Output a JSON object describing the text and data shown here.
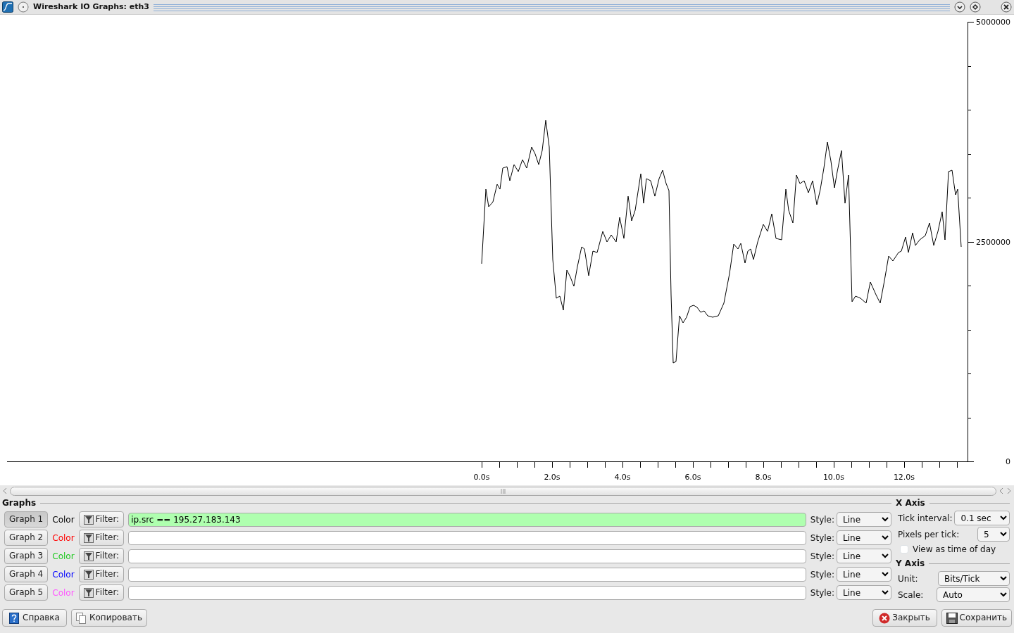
{
  "window": {
    "title": "Wireshark IO Graphs: eth3"
  },
  "chart": {
    "chart_data": {
      "type": "line",
      "x": [
        0,
        0.12,
        0.2,
        0.32,
        0.44,
        0.52,
        0.6,
        0.72,
        0.8,
        0.92,
        1.04,
        1.16,
        1.28,
        1.42,
        1.52,
        1.62,
        1.72,
        1.82,
        1.92,
        2.02,
        2.12,
        2.22,
        2.32,
        2.42,
        2.52,
        2.62,
        2.72,
        2.84,
        2.92,
        3.04,
        3.16,
        3.28,
        3.44,
        3.56,
        3.68,
        3.82,
        3.92,
        4.04,
        4.16,
        4.26,
        4.36,
        4.52,
        4.6,
        4.68,
        4.8,
        4.92,
        5.04,
        5.14,
        5.24,
        5.32,
        5.38,
        5.44,
        5.52,
        5.62,
        5.72,
        5.82,
        5.92,
        6.02,
        6.12,
        6.22,
        6.32,
        6.42,
        6.56,
        6.72,
        6.88,
        7.04,
        7.16,
        7.28,
        7.36,
        7.48,
        7.56,
        7.64,
        7.72,
        7.84,
        8.0,
        8.12,
        8.24,
        8.36,
        8.52,
        8.64,
        8.72,
        8.84,
        8.94,
        9.04,
        9.16,
        9.28,
        9.4,
        9.52,
        9.62,
        9.72,
        9.82,
        9.92,
        10.02,
        10.1,
        10.22,
        10.32,
        10.42,
        10.52,
        10.62,
        10.76,
        10.92,
        11.04,
        11.2,
        11.32,
        11.44,
        11.56,
        11.68,
        11.84,
        11.92,
        12.04,
        12.12,
        12.24,
        12.32,
        12.44,
        12.6,
        12.72,
        12.84,
        12.96,
        13.08,
        13.16,
        13.26,
        13.36,
        13.46,
        13.52,
        13.62
      ],
      "series": [
        {
          "color": "#000000",
          "values": [
            2248000,
            3096000,
            2896000,
            2952000,
            3152000,
            3096000,
            3336000,
            3352000,
            3192000,
            3376000,
            3296000,
            3432000,
            3336000,
            3576000,
            3496000,
            3376000,
            3536000,
            3880000,
            3576000,
            2296000,
            1856000,
            1880000,
            1720000,
            2176000,
            2096000,
            1992000,
            2216000,
            2440000,
            2416000,
            2112000,
            2392000,
            2376000,
            2616000,
            2496000,
            2576000,
            2496000,
            2776000,
            2536000,
            3016000,
            2736000,
            2856000,
            3272000,
            2936000,
            3216000,
            3192000,
            3016000,
            3216000,
            3312000,
            3160000,
            3080000,
            1896000,
            1120000,
            1136000,
            1656000,
            1576000,
            1640000,
            1760000,
            1776000,
            1752000,
            1696000,
            1712000,
            1656000,
            1640000,
            1656000,
            1800000,
            2136000,
            2472000,
            2416000,
            2480000,
            2256000,
            2392000,
            2416000,
            2296000,
            2496000,
            2696000,
            2616000,
            2816000,
            2536000,
            2520000,
            3096000,
            2856000,
            2712000,
            3256000,
            3160000,
            3192000,
            3056000,
            3192000,
            2920000,
            3096000,
            3336000,
            3632000,
            3416000,
            3112000,
            3296000,
            3536000,
            2936000,
            3256000,
            1816000,
            1880000,
            1856000,
            1800000,
            2040000,
            1896000,
            1800000,
            2056000,
            2336000,
            2280000,
            2376000,
            2392000,
            2552000,
            2376000,
            2600000,
            2456000,
            2520000,
            2568000,
            2712000,
            2456000,
            2616000,
            2840000,
            2520000,
            3296000,
            3312000,
            3032000,
            3096000,
            2440000
          ]
        }
      ],
      "xlim": [
        -13.48,
        13.8
      ],
      "ylim": [
        0,
        5000000
      ],
      "xticks": [
        {
          "value": 0,
          "label": "0.0s"
        },
        {
          "value": 2,
          "label": "2.0s"
        },
        {
          "value": 4,
          "label": "4.0s"
        },
        {
          "value": 6,
          "label": "6.0s"
        },
        {
          "value": 8,
          "label": "8.0s"
        },
        {
          "value": 10,
          "label": "10.0s"
        },
        {
          "value": 12,
          "label": "12.0s"
        }
      ],
      "yticks": [
        0,
        2500000,
        5000000
      ]
    }
  },
  "graphs_section": {
    "title": "Graphs",
    "rows": [
      {
        "button": "Graph 1",
        "selected": true,
        "color_label": "Color",
        "color": "#000000",
        "filter_button": "Filter:",
        "filter": "ip.src == 195.27.183.143",
        "filter_valid": true,
        "style_label": "Style:",
        "style": "Line"
      },
      {
        "button": "Graph 2",
        "selected": false,
        "color_label": "Color",
        "color": "#ff0000",
        "filter_button": "Filter:",
        "filter_valid": false,
        "style_label": "Style:",
        "style": "Line"
      },
      {
        "button": "Graph 3",
        "selected": false,
        "color_label": "Color",
        "color": "#1ec81e",
        "filter_button": "Filter:",
        "filter_valid": false,
        "style_label": "Style:",
        "style": "Line"
      },
      {
        "button": "Graph 4",
        "selected": false,
        "color_label": "Color",
        "color": "#0000ff",
        "filter_button": "Filter:",
        "filter_valid": false,
        "style_label": "Style:",
        "style": "Line"
      },
      {
        "button": "Graph 5",
        "selected": false,
        "color_label": "Color",
        "color": "#ff55ff",
        "filter_button": "Filter:",
        "filter_valid": false,
        "style_label": "Style:",
        "style": "Line"
      }
    ]
  },
  "x_axis": {
    "title": "X Axis",
    "tick_interval_label": "Tick interval:",
    "tick_interval": "0.1 sec",
    "pixels_per_tick_label": "Pixels per tick:",
    "pixels_per_tick": "5",
    "time_of_day": {
      "label": "View as time of day",
      "checked": false
    }
  },
  "y_axis": {
    "title": "Y Axis",
    "unit_label": "Unit:",
    "unit": "Bits/Tick",
    "scale_label": "Scale:",
    "scale": "Auto"
  },
  "buttons": [
    {
      "kind": "help",
      "label": "Справка"
    },
    {
      "kind": "copy",
      "label": "Копировать"
    },
    {
      "kind": "close",
      "label": "Закрыть"
    },
    {
      "kind": "save",
      "label": "Сохранить"
    }
  ]
}
